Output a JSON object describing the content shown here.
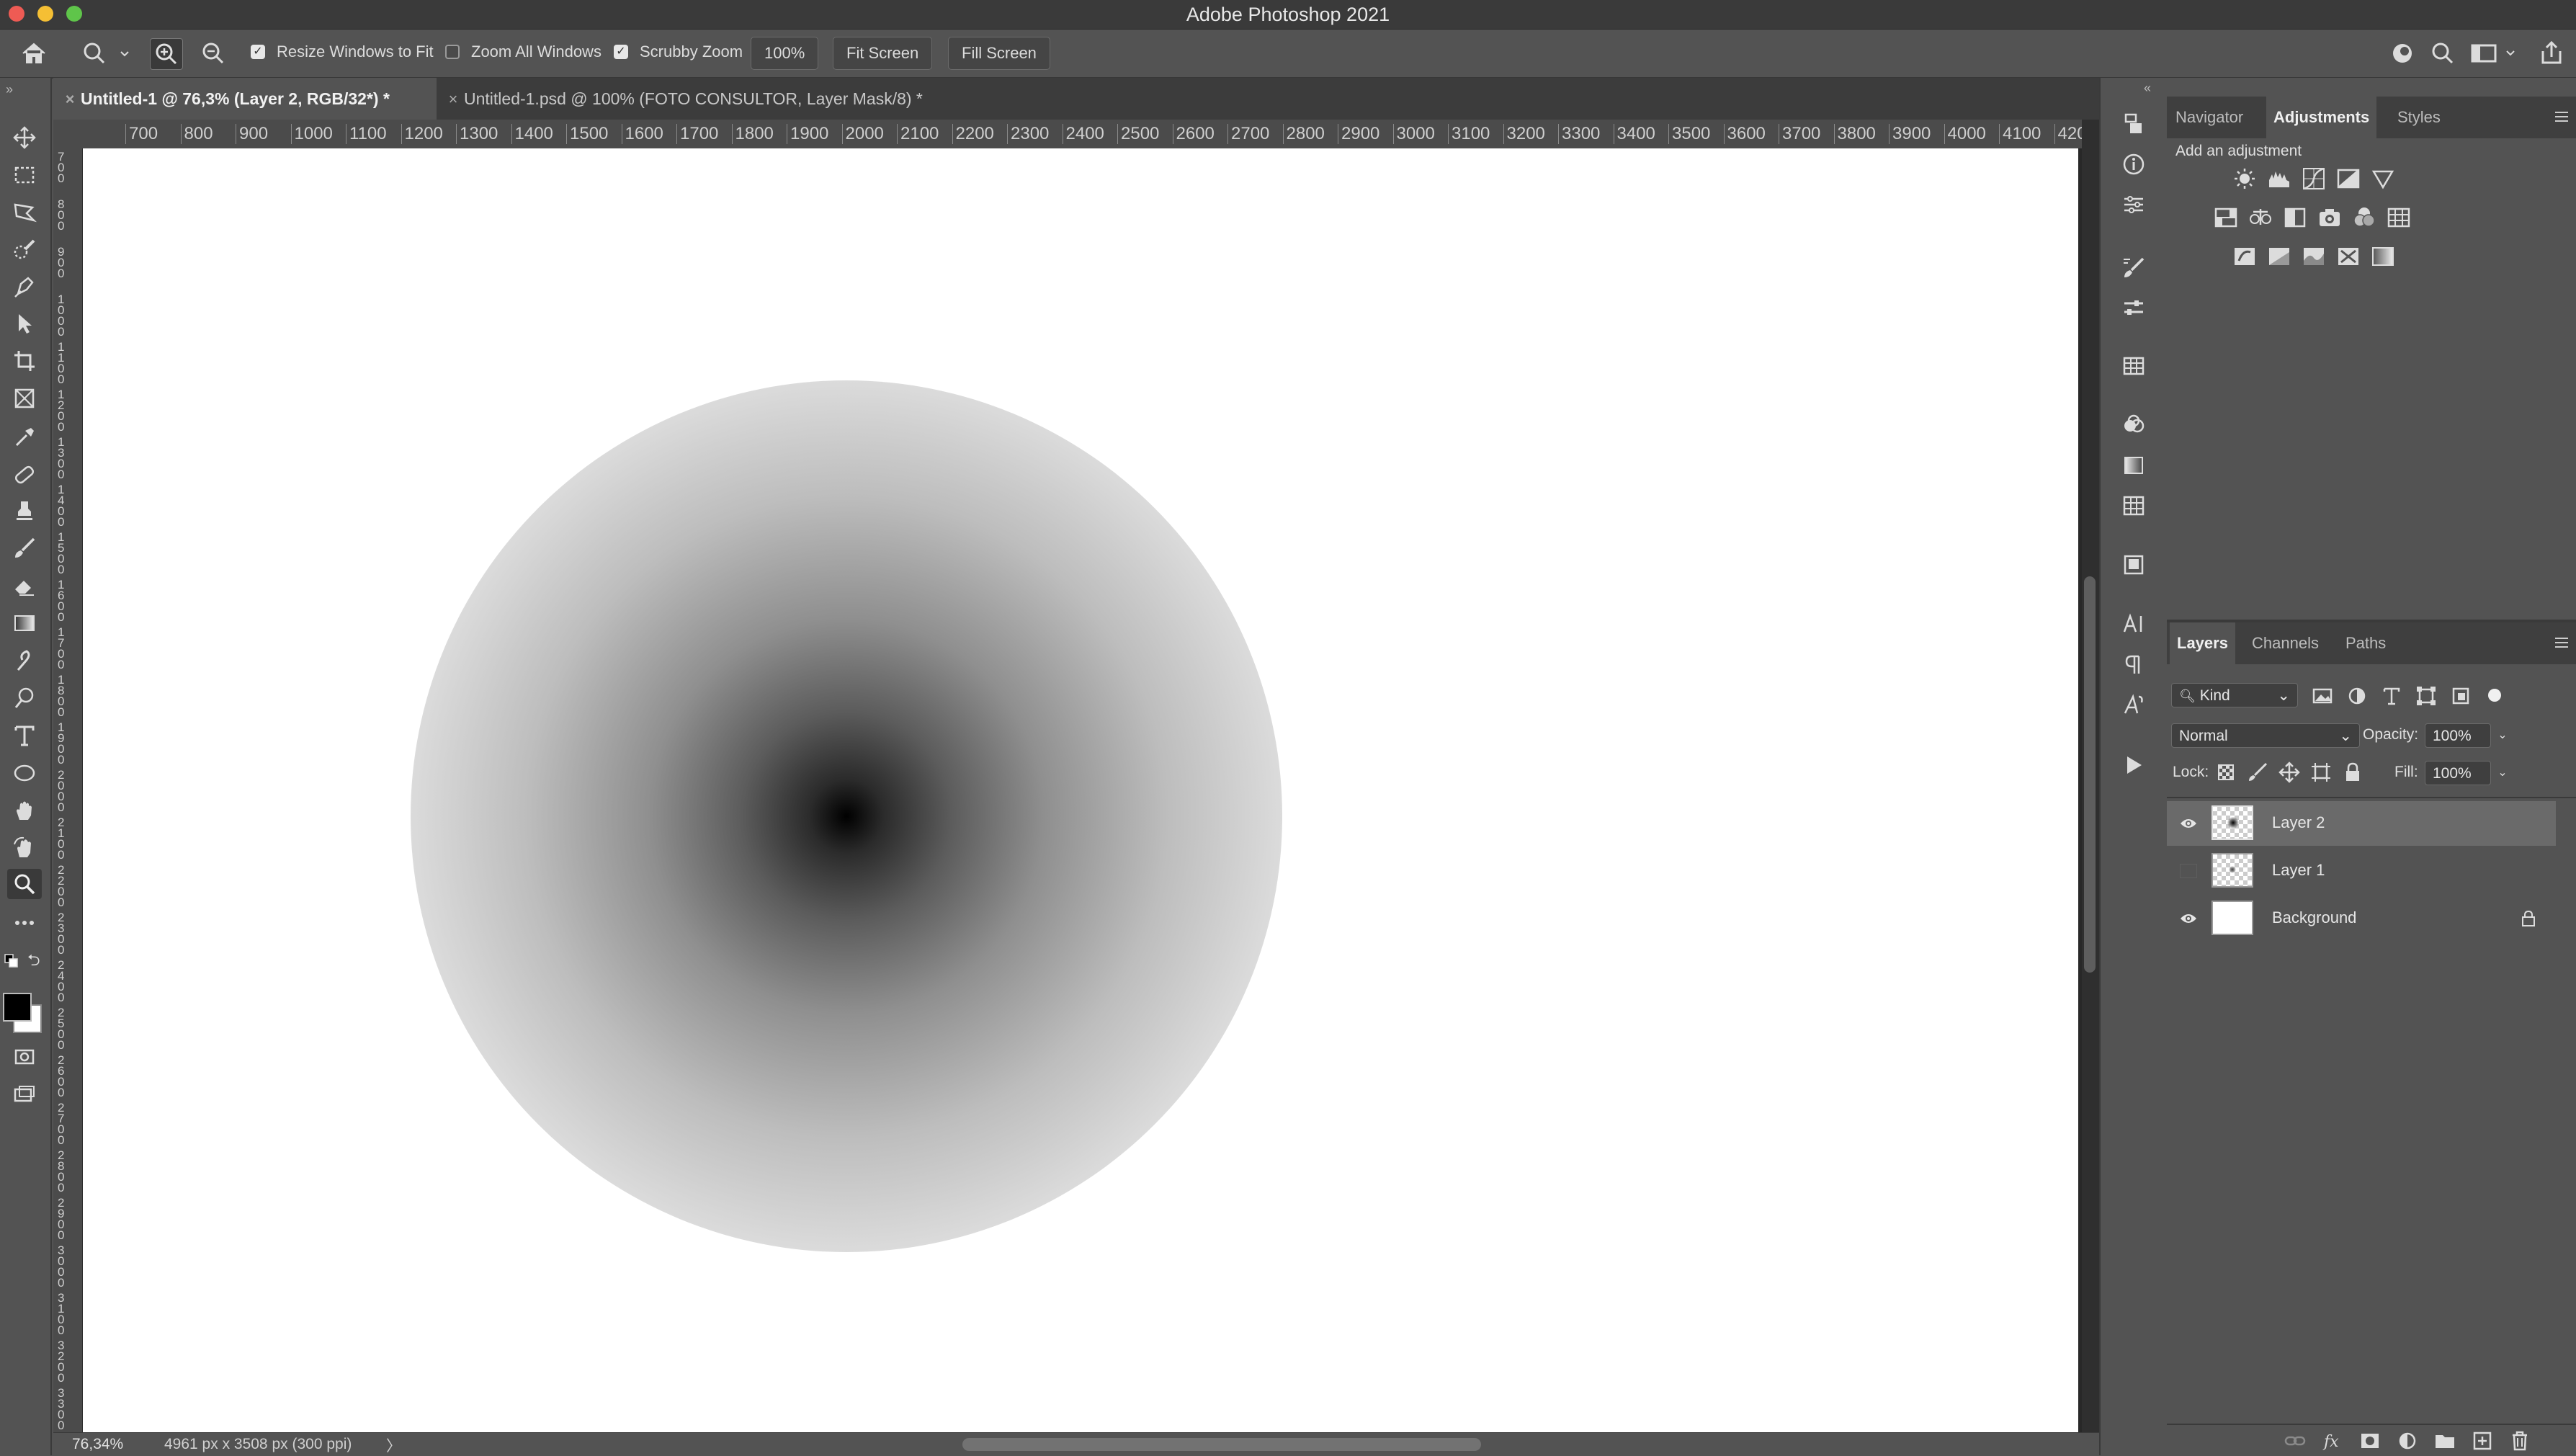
{
  "app": {
    "title": "Adobe Photoshop 2021"
  },
  "colors": {
    "accent": "#2f7ad6",
    "panel": "#535353",
    "dark": "#3a3a3a"
  },
  "options_bar": {
    "tool_icon": "zoom-icon",
    "resize_windows_label": "Resize Windows to Fit",
    "resize_windows_checked": true,
    "zoom_all_label": "Zoom All Windows",
    "zoom_all_checked": false,
    "scrubby_label": "Scrubby Zoom",
    "scrubby_checked": true,
    "zoom_value": "100%",
    "fit_screen": "Fit Screen",
    "fill_screen": "Fill Screen"
  },
  "tabs": [
    {
      "label": "Untitled-1 @ 76,3% (Layer 2, RGB/32*) *",
      "active": true
    },
    {
      "label": "Untitled-1.psd @ 100% (FOTO CONSULTOR, Layer Mask/8) *",
      "active": false
    }
  ],
  "ruler": {
    "h": [
      "700",
      "800",
      "900",
      "1000",
      "1100",
      "1200",
      "1300",
      "1400",
      "1500",
      "1600",
      "1700",
      "1800",
      "1900",
      "2000",
      "2100",
      "2200",
      "2300",
      "2400",
      "2500",
      "2600",
      "2700",
      "2800",
      "2900",
      "3000",
      "3100",
      "3200",
      "3300",
      "3400",
      "3500",
      "3600",
      "3700",
      "3800",
      "3900",
      "4000",
      "4100",
      "420"
    ],
    "v": [
      "700",
      "800",
      "900",
      "1000",
      "1100",
      "1200",
      "1300",
      "1400",
      "1500",
      "1600",
      "1700",
      "1800",
      "1900",
      "2000",
      "2100",
      "2200",
      "2300",
      "2400",
      "2500",
      "2600",
      "2700",
      "2800",
      "2900",
      "3000",
      "3100",
      "3200",
      "3300"
    ]
  },
  "status": {
    "zoom": "76,34%",
    "doc_size": "4961 px x 3508 px (300 ppi)",
    "arrow": "〉"
  },
  "top_panel": {
    "tabs": [
      "Navigator",
      "Adjustments",
      "Styles"
    ],
    "active_tab": "Adjustments",
    "heading": "Add an adjustment"
  },
  "layers_panel": {
    "tabs": [
      "Layers",
      "Channels",
      "Paths"
    ],
    "active_tab": "Layers",
    "filter": "Kind",
    "blend_mode": "Normal",
    "opacity_label": "Opacity:",
    "opacity": "100%",
    "lock_label": "Lock:",
    "fill_label": "Fill:",
    "fill": "100%",
    "layers": [
      {
        "name": "Layer 2",
        "visible": true,
        "selected": true
      },
      {
        "name": "Layer 1",
        "visible": false,
        "selected": false
      },
      {
        "name": "Background",
        "visible": true,
        "selected": false,
        "locked": true
      }
    ]
  }
}
